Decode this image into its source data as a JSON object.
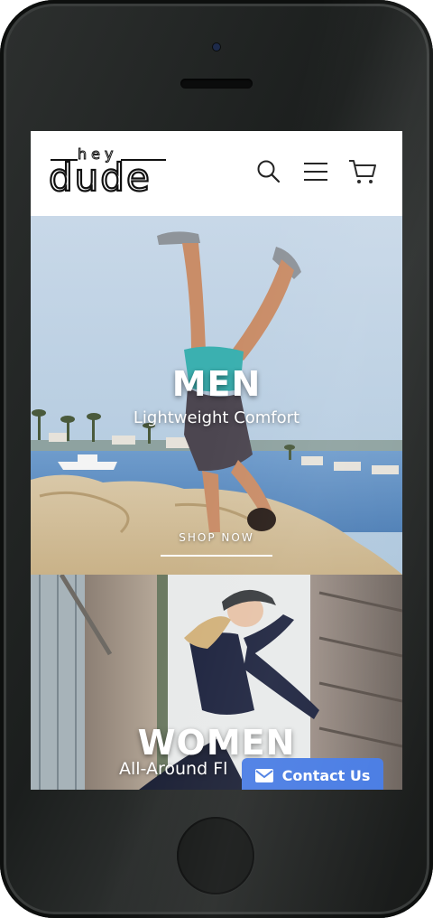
{
  "header": {
    "logo_top": "hey",
    "logo_main": "dude",
    "icons": [
      "search-icon",
      "menu-icon",
      "cart-icon"
    ]
  },
  "hero_men": {
    "title": "MEN",
    "subtitle": "Lightweight Comfort",
    "cta": "SHOP NOW"
  },
  "hero_women": {
    "title": "WOMEN",
    "subtitle": "All-Around Fl"
  },
  "contact": {
    "label": "Contact Us",
    "icon": "mail-icon",
    "color": "#4a7de4"
  }
}
